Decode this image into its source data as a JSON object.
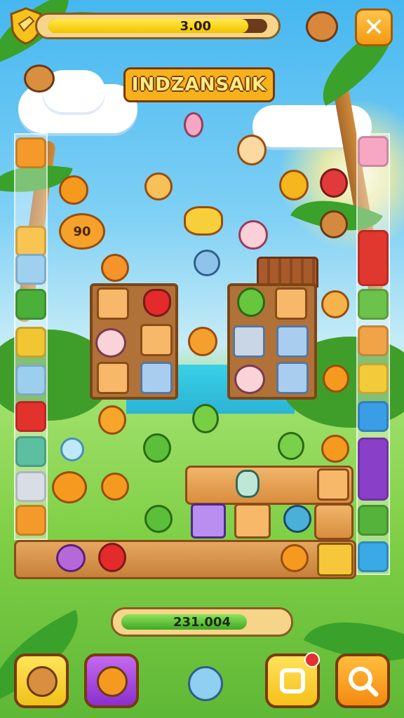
{
  "hud": {
    "progress_value": "3.00",
    "progress_fraction": 0.95,
    "logo_text": "INDZANSAIK",
    "close_icon": "close-icon",
    "shield_icon": "shield-icon"
  },
  "board_badge": "90",
  "score": {
    "value": "231.004",
    "fraction": 0.78
  },
  "boosters": [
    {
      "name": "bear-booster",
      "icon": "bear-icon",
      "color": "#f5d327"
    },
    {
      "name": "bomb-booster",
      "icon": "bomb-icon",
      "color": "#a23bd6"
    },
    {
      "name": "shuffle-booster",
      "icon": "shuffle-icon",
      "color": "#f5c320",
      "badge": true
    },
    {
      "name": "search-booster",
      "icon": "magnifier-icon",
      "color": "#f59a12"
    }
  ],
  "colors": {
    "accent": "#f7b21b",
    "progress": "#f0c400",
    "score": "#3fa824",
    "wood": "#8b4b18"
  }
}
